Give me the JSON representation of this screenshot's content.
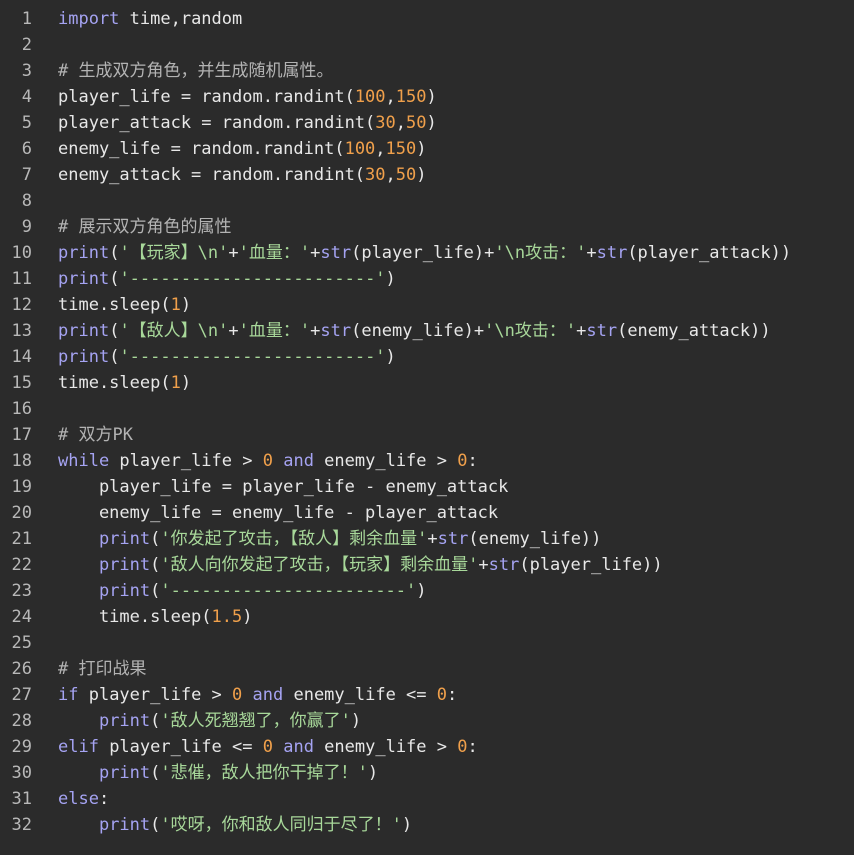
{
  "editor": {
    "lines": [
      {
        "n": "1",
        "segs": [
          {
            "t": "kw",
            "v": "import"
          },
          {
            "t": "txt",
            "v": " time,random"
          }
        ]
      },
      {
        "n": "2",
        "segs": []
      },
      {
        "n": "3",
        "segs": [
          {
            "t": "com",
            "v": "# 生成双方角色，并生成随机属性。"
          }
        ]
      },
      {
        "n": "4",
        "segs": [
          {
            "t": "txt",
            "v": "player_life = random.randint("
          },
          {
            "t": "num",
            "v": "100"
          },
          {
            "t": "txt",
            "v": ","
          },
          {
            "t": "num",
            "v": "150"
          },
          {
            "t": "txt",
            "v": ")"
          }
        ]
      },
      {
        "n": "5",
        "segs": [
          {
            "t": "txt",
            "v": "player_attack = random.randint("
          },
          {
            "t": "num",
            "v": "30"
          },
          {
            "t": "txt",
            "v": ","
          },
          {
            "t": "num",
            "v": "50"
          },
          {
            "t": "txt",
            "v": ")"
          }
        ]
      },
      {
        "n": "6",
        "segs": [
          {
            "t": "txt",
            "v": "enemy_life = random.randint("
          },
          {
            "t": "num",
            "v": "100"
          },
          {
            "t": "txt",
            "v": ","
          },
          {
            "t": "num",
            "v": "150"
          },
          {
            "t": "txt",
            "v": ")"
          }
        ]
      },
      {
        "n": "7",
        "segs": [
          {
            "t": "txt",
            "v": "enemy_attack = random.randint("
          },
          {
            "t": "num",
            "v": "30"
          },
          {
            "t": "txt",
            "v": ","
          },
          {
            "t": "num",
            "v": "50"
          },
          {
            "t": "txt",
            "v": ")"
          }
        ]
      },
      {
        "n": "8",
        "segs": []
      },
      {
        "n": "9",
        "segs": [
          {
            "t": "com",
            "v": "# 展示双方角色的属性"
          }
        ]
      },
      {
        "n": "10",
        "segs": [
          {
            "t": "kw",
            "v": "print"
          },
          {
            "t": "txt",
            "v": "("
          },
          {
            "t": "str",
            "v": "'【玩家】\\n'"
          },
          {
            "t": "txt",
            "v": "+"
          },
          {
            "t": "str",
            "v": "'血量：'"
          },
          {
            "t": "txt",
            "v": "+"
          },
          {
            "t": "kw",
            "v": "str"
          },
          {
            "t": "txt",
            "v": "(player_life)+"
          },
          {
            "t": "str",
            "v": "'\\n攻击：'"
          },
          {
            "t": "txt",
            "v": "+"
          },
          {
            "t": "kw",
            "v": "str"
          },
          {
            "t": "txt",
            "v": "(player_attack))"
          }
        ]
      },
      {
        "n": "11",
        "segs": [
          {
            "t": "kw",
            "v": "print"
          },
          {
            "t": "txt",
            "v": "("
          },
          {
            "t": "str",
            "v": "'------------------------'"
          },
          {
            "t": "txt",
            "v": ")"
          }
        ]
      },
      {
        "n": "12",
        "segs": [
          {
            "t": "txt",
            "v": "time.sleep("
          },
          {
            "t": "num",
            "v": "1"
          },
          {
            "t": "txt",
            "v": ")"
          }
        ]
      },
      {
        "n": "13",
        "segs": [
          {
            "t": "kw",
            "v": "print"
          },
          {
            "t": "txt",
            "v": "("
          },
          {
            "t": "str",
            "v": "'【敌人】\\n'"
          },
          {
            "t": "txt",
            "v": "+"
          },
          {
            "t": "str",
            "v": "'血量：'"
          },
          {
            "t": "txt",
            "v": "+"
          },
          {
            "t": "kw",
            "v": "str"
          },
          {
            "t": "txt",
            "v": "(enemy_life)+"
          },
          {
            "t": "str",
            "v": "'\\n攻击：'"
          },
          {
            "t": "txt",
            "v": "+"
          },
          {
            "t": "kw",
            "v": "str"
          },
          {
            "t": "txt",
            "v": "(enemy_attack))"
          }
        ]
      },
      {
        "n": "14",
        "segs": [
          {
            "t": "kw",
            "v": "print"
          },
          {
            "t": "txt",
            "v": "("
          },
          {
            "t": "str",
            "v": "'------------------------'"
          },
          {
            "t": "txt",
            "v": ")"
          }
        ]
      },
      {
        "n": "15",
        "segs": [
          {
            "t": "txt",
            "v": "time.sleep("
          },
          {
            "t": "num",
            "v": "1"
          },
          {
            "t": "txt",
            "v": ")"
          }
        ]
      },
      {
        "n": "16",
        "segs": []
      },
      {
        "n": "17",
        "segs": [
          {
            "t": "com",
            "v": "# 双方PK"
          }
        ]
      },
      {
        "n": "18",
        "segs": [
          {
            "t": "kw",
            "v": "while"
          },
          {
            "t": "txt",
            "v": " player_life > "
          },
          {
            "t": "num",
            "v": "0"
          },
          {
            "t": "txt",
            "v": " "
          },
          {
            "t": "kw",
            "v": "and"
          },
          {
            "t": "txt",
            "v": " enemy_life > "
          },
          {
            "t": "num",
            "v": "0"
          },
          {
            "t": "txt",
            "v": ":"
          }
        ]
      },
      {
        "n": "19",
        "segs": [
          {
            "t": "txt",
            "v": "    player_life = player_life - enemy_attack"
          }
        ]
      },
      {
        "n": "20",
        "segs": [
          {
            "t": "txt",
            "v": "    enemy_life = enemy_life - player_attack"
          }
        ]
      },
      {
        "n": "21",
        "segs": [
          {
            "t": "txt",
            "v": "    "
          },
          {
            "t": "kw",
            "v": "print"
          },
          {
            "t": "txt",
            "v": "("
          },
          {
            "t": "str",
            "v": "'你发起了攻击，【敌人】剩余血量'"
          },
          {
            "t": "txt",
            "v": "+"
          },
          {
            "t": "kw",
            "v": "str"
          },
          {
            "t": "txt",
            "v": "(enemy_life))"
          }
        ]
      },
      {
        "n": "22",
        "segs": [
          {
            "t": "txt",
            "v": "    "
          },
          {
            "t": "kw",
            "v": "print"
          },
          {
            "t": "txt",
            "v": "("
          },
          {
            "t": "str",
            "v": "'敌人向你发起了攻击，【玩家】剩余血量'"
          },
          {
            "t": "txt",
            "v": "+"
          },
          {
            "t": "kw",
            "v": "str"
          },
          {
            "t": "txt",
            "v": "(player_life))"
          }
        ]
      },
      {
        "n": "23",
        "segs": [
          {
            "t": "txt",
            "v": "    "
          },
          {
            "t": "kw",
            "v": "print"
          },
          {
            "t": "txt",
            "v": "("
          },
          {
            "t": "str",
            "v": "'-----------------------'"
          },
          {
            "t": "txt",
            "v": ")"
          }
        ]
      },
      {
        "n": "24",
        "segs": [
          {
            "t": "txt",
            "v": "    time.sleep("
          },
          {
            "t": "num",
            "v": "1.5"
          },
          {
            "t": "txt",
            "v": ")"
          }
        ]
      },
      {
        "n": "25",
        "segs": []
      },
      {
        "n": "26",
        "segs": [
          {
            "t": "com",
            "v": "# 打印战果"
          }
        ]
      },
      {
        "n": "27",
        "segs": [
          {
            "t": "kw",
            "v": "if"
          },
          {
            "t": "txt",
            "v": " player_life > "
          },
          {
            "t": "num",
            "v": "0"
          },
          {
            "t": "txt",
            "v": " "
          },
          {
            "t": "kw",
            "v": "and"
          },
          {
            "t": "txt",
            "v": " enemy_life <= "
          },
          {
            "t": "num",
            "v": "0"
          },
          {
            "t": "txt",
            "v": ":"
          }
        ]
      },
      {
        "n": "28",
        "segs": [
          {
            "t": "txt",
            "v": "    "
          },
          {
            "t": "kw",
            "v": "print"
          },
          {
            "t": "txt",
            "v": "("
          },
          {
            "t": "str",
            "v": "'敌人死翘翘了，你赢了'"
          },
          {
            "t": "txt",
            "v": ")"
          }
        ]
      },
      {
        "n": "29",
        "segs": [
          {
            "t": "kw",
            "v": "elif"
          },
          {
            "t": "txt",
            "v": " player_life <= "
          },
          {
            "t": "num",
            "v": "0"
          },
          {
            "t": "txt",
            "v": " "
          },
          {
            "t": "kw",
            "v": "and"
          },
          {
            "t": "txt",
            "v": " enemy_life > "
          },
          {
            "t": "num",
            "v": "0"
          },
          {
            "t": "txt",
            "v": ":"
          }
        ]
      },
      {
        "n": "30",
        "segs": [
          {
            "t": "txt",
            "v": "    "
          },
          {
            "t": "kw",
            "v": "print"
          },
          {
            "t": "txt",
            "v": "("
          },
          {
            "t": "str",
            "v": "'悲催，敌人把你干掉了！'"
          },
          {
            "t": "txt",
            "v": ")"
          }
        ]
      },
      {
        "n": "31",
        "segs": [
          {
            "t": "kw",
            "v": "else"
          },
          {
            "t": "txt",
            "v": ":"
          }
        ]
      },
      {
        "n": "32",
        "segs": [
          {
            "t": "txt",
            "v": "    "
          },
          {
            "t": "kw",
            "v": "print"
          },
          {
            "t": "txt",
            "v": "("
          },
          {
            "t": "str",
            "v": "'哎呀，你和敌人同归于尽了！'"
          },
          {
            "t": "txt",
            "v": ")"
          }
        ]
      }
    ]
  },
  "theme": {
    "background": "#2b2b2b",
    "keyword": "#a5a3f2",
    "string": "#a8d89a",
    "number": "#f0a04b",
    "comment": "#b3b3b3",
    "text": "#e8e8e8",
    "line_number": "#b8b8b8"
  }
}
